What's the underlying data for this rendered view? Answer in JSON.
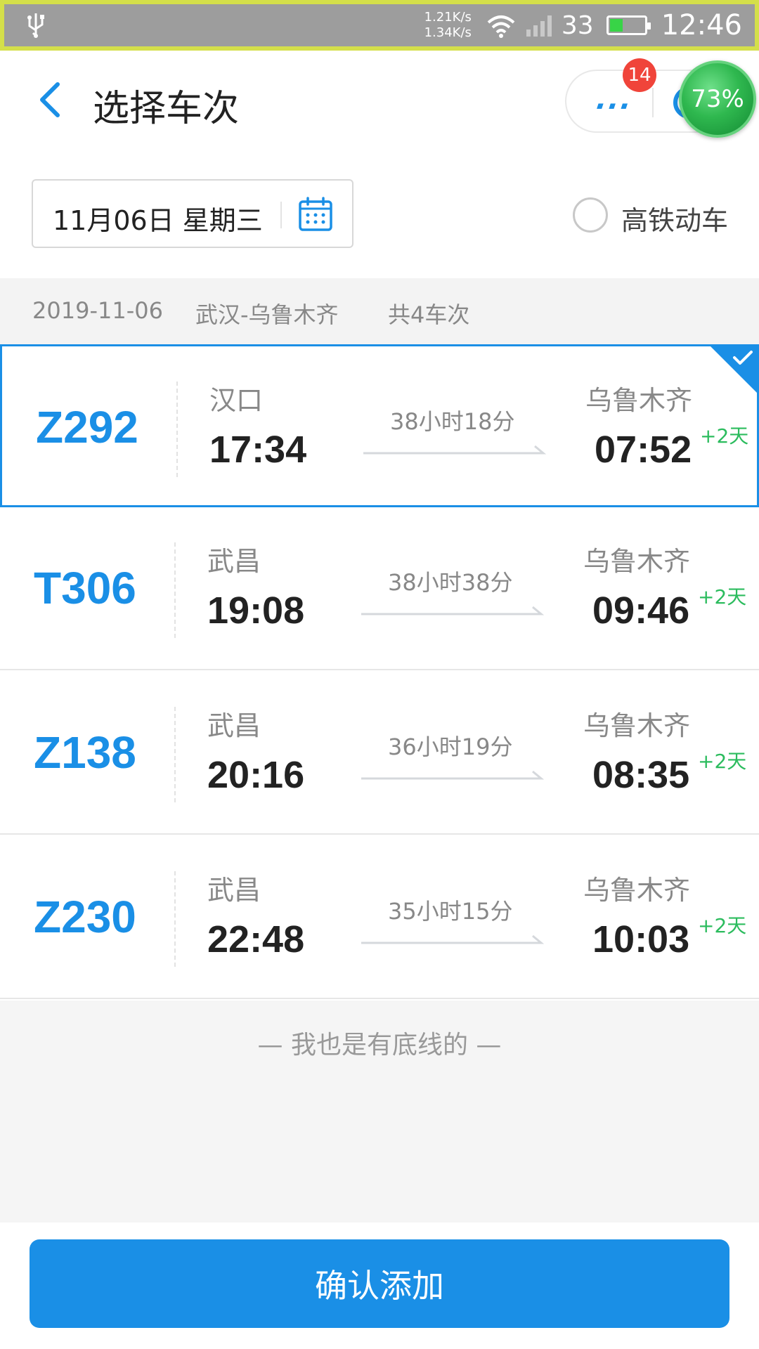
{
  "status_bar": {
    "net_up": "1.21K/s",
    "net_down": "1.34K/s",
    "signal": "33",
    "battery_level": 0.35,
    "time": "12:46",
    "usb_icon": "usb-icon",
    "wifi_icon": "wifi-icon"
  },
  "header": {
    "title": "选择车次",
    "capsule_more": "···",
    "badge_count": "14",
    "percent": "73%"
  },
  "date_picker": {
    "date_label": "11月06日 星期三"
  },
  "filter": {
    "high_speed_label": "高铁动车",
    "checked": false
  },
  "summary": {
    "date": "2019-11-06",
    "route": "武汉-乌鲁木齐",
    "count": "共4车次"
  },
  "trains": [
    {
      "no": "Z292",
      "from": "汉口",
      "dep": "17:34",
      "duration": "38小时18分",
      "to": "乌鲁木齐",
      "arr": "07:52",
      "plus_day": "+2天",
      "selected": true
    },
    {
      "no": "T306",
      "from": "武昌",
      "dep": "19:08",
      "duration": "38小时38分",
      "to": "乌鲁木齐",
      "arr": "09:46",
      "plus_day": "+2天",
      "selected": false
    },
    {
      "no": "Z138",
      "from": "武昌",
      "dep": "20:16",
      "duration": "36小时19分",
      "to": "乌鲁木齐",
      "arr": "08:35",
      "plus_day": "+2天",
      "selected": false
    },
    {
      "no": "Z230",
      "from": "武昌",
      "dep": "22:48",
      "duration": "35小时15分",
      "to": "乌鲁木齐",
      "arr": "10:03",
      "plus_day": "+2天",
      "selected": false
    }
  ],
  "footer": {
    "bottom_line_text": "— 我也是有底线的 —",
    "confirm_label": "确认添加"
  },
  "colors": {
    "accent": "#1a8fe6",
    "green": "#2cbc5e"
  }
}
